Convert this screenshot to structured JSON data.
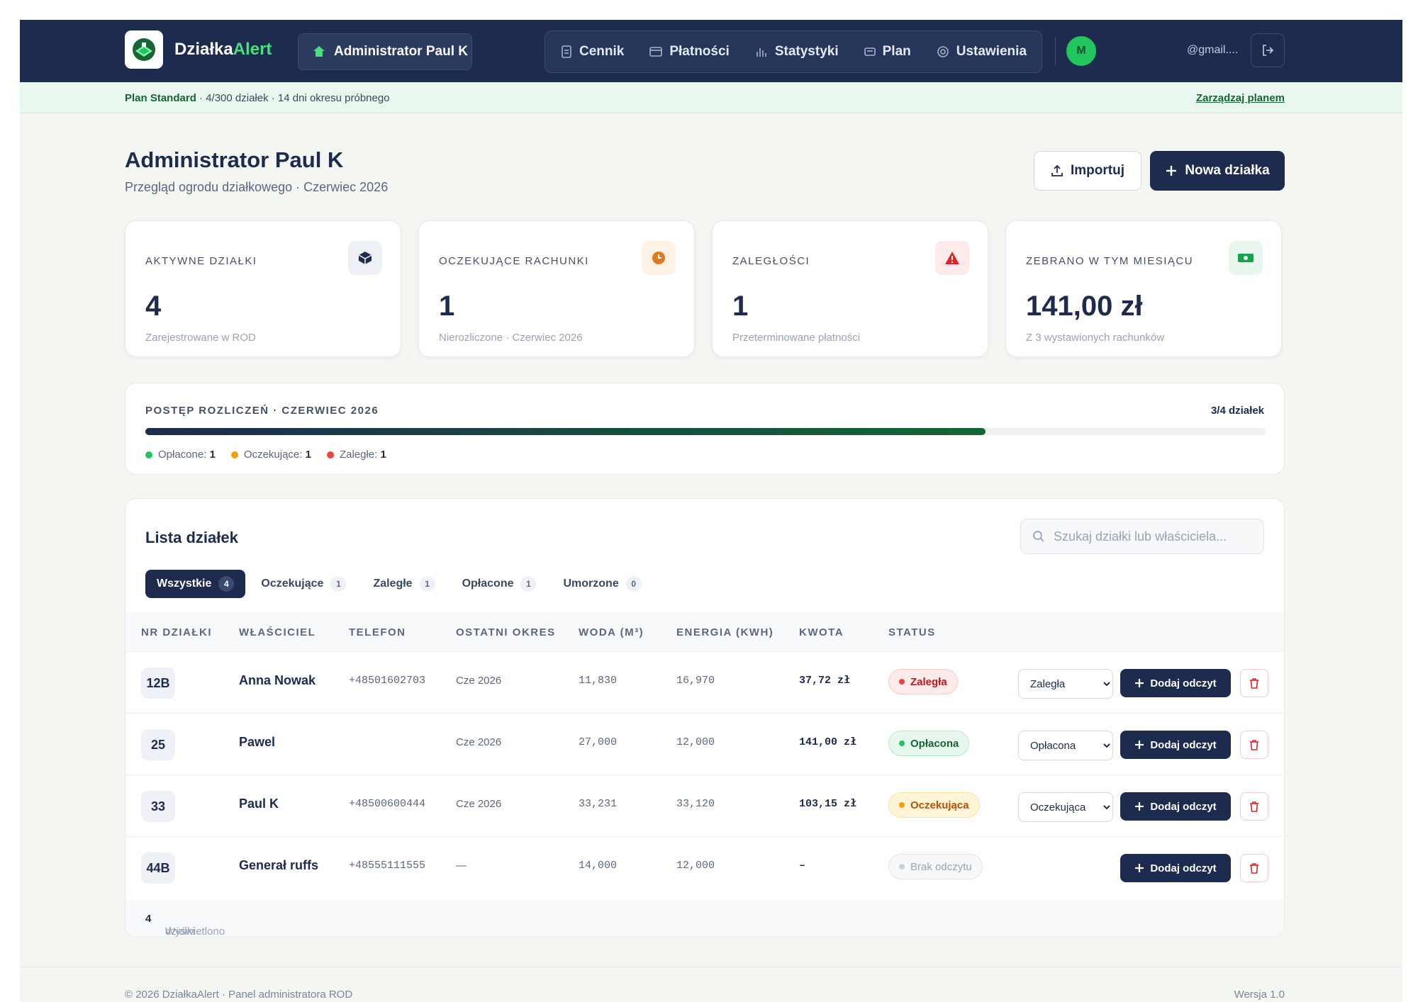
{
  "brand": {
    "name_part1": "Działka",
    "name_part2": "Alert"
  },
  "header": {
    "admin_label": "Administrator Paul K",
    "nav": [
      {
        "label": "Cennik",
        "icon": "document-icon"
      },
      {
        "label": "Płatności",
        "icon": "card-icon"
      },
      {
        "label": "Statystyki",
        "icon": "bar-chart-icon"
      },
      {
        "label": "Plan",
        "icon": "plan-card-icon"
      },
      {
        "label": "Ustawienia",
        "icon": "gear-icon"
      }
    ],
    "avatar_initial": "M",
    "email": "@gmail...."
  },
  "plan": {
    "name": "Plan Standard",
    "details": " · 4/300 działek · 14 dni okresu próbnego",
    "manage_link": "Zarządzaj planem"
  },
  "page": {
    "title": "Administrator Paul K",
    "subtitle": "Przegląd ogrodu działkowego · Czerwiec 2026",
    "import_label": "Importuj",
    "new_label": "Nowa działka"
  },
  "stats": [
    {
      "label": "AKTYWNE DZIAŁKI",
      "value": "4",
      "note": "Zarejestrowane w ROD",
      "icon": "cube-icon",
      "icon_bg": "#eef1f5",
      "icon_color": "#1d2b4f"
    },
    {
      "label": "OCZEKUJĄCE RACHUNKI",
      "value": "1",
      "note": "Nierozliczone · Czerwiec 2026",
      "icon": "clock-icon",
      "icon_bg": "#fff1e3",
      "icon_color": "#e07a1f"
    },
    {
      "label": "ZALEGŁOŚCI",
      "value": "1",
      "note": "Przeterminowane płatności",
      "icon": "warning-icon",
      "icon_bg": "#fdeaea",
      "icon_color": "#dc2626"
    },
    {
      "label": "ZEBRANO W TYM MIESIĄCU",
      "value": "141,00 zł",
      "note": "Z 3 wystawionych rachunków",
      "icon": "cash-icon",
      "icon_bg": "#e8f7ee",
      "icon_color": "#16a34a"
    }
  ],
  "progress": {
    "label": "POSTĘP ROZLICZEŃ · CZERWIEC 2026",
    "count_label": "3/4 działek",
    "fraction": 0.75,
    "legend": [
      {
        "label": "Opłacone:",
        "value": "1",
        "color": "#22c55e"
      },
      {
        "label": "Oczekujące:",
        "value": "1",
        "color": "#f59e0b"
      },
      {
        "label": "Zaległe:",
        "value": "1",
        "color": "#ef4444"
      }
    ]
  },
  "list": {
    "title": "Lista działek",
    "search_placeholder": "Szukaj działki lub właściciela...",
    "tabs": [
      {
        "label": "Wszystkie",
        "count": "4",
        "active": true
      },
      {
        "label": "Oczekujące",
        "count": "1",
        "active": false
      },
      {
        "label": "Zaległe",
        "count": "1",
        "active": false
      },
      {
        "label": "Opłacone",
        "count": "1",
        "active": false
      },
      {
        "label": "Umorzone",
        "count": "0",
        "active": false
      }
    ],
    "columns": [
      "NR DZIAŁKI",
      "WŁAŚCICIEL",
      "TELEFON",
      "OSTATNI OKRES",
      "WODA (M³)",
      "ENERGIA (KWH)",
      "KWOTA",
      "STATUS"
    ],
    "rows": [
      {
        "plot": "12B",
        "owner": "Anna Nowak",
        "phone": "+48501602703",
        "period": "Cze 2026",
        "water": "11,830",
        "energy": "16,970",
        "amount": "37,72 zł",
        "status": "Zaległa",
        "status_type": "overdue",
        "select": "Zaległa"
      },
      {
        "plot": "25",
        "owner": "Pawel",
        "phone": "",
        "period": "Cze 2026",
        "water": "27,000",
        "energy": "12,000",
        "amount": "141,00 zł",
        "status": "Opłacona",
        "status_type": "paid",
        "select": "Opłacona"
      },
      {
        "plot": "33",
        "owner": "Paul K",
        "phone": "+48500600444",
        "period": "Cze 2026",
        "water": "33,231",
        "energy": "33,120",
        "amount": "103,15 zł",
        "status": "Oczekująca",
        "status_type": "pending",
        "select": "Oczekująca"
      },
      {
        "plot": "44B",
        "owner": "Generał ruffs",
        "phone": "+48555111555",
        "period": "—",
        "water": "14,000",
        "energy": "12,000",
        "amount": "–",
        "status": "Brak odczytu",
        "status_type": "none",
        "select": ""
      }
    ],
    "select_options": [
      "Zaległa",
      "Opłacona",
      "Oczekująca"
    ],
    "add_reading_label": "Dodaj odczyt",
    "footer_prefix": "Wyświetlono",
    "footer_count": "4",
    "footer_suffix": "działki"
  },
  "footer": {
    "left": "© 2026 DziałkaAlert · Panel administratora ROD",
    "right": "Wersja 1.0"
  }
}
